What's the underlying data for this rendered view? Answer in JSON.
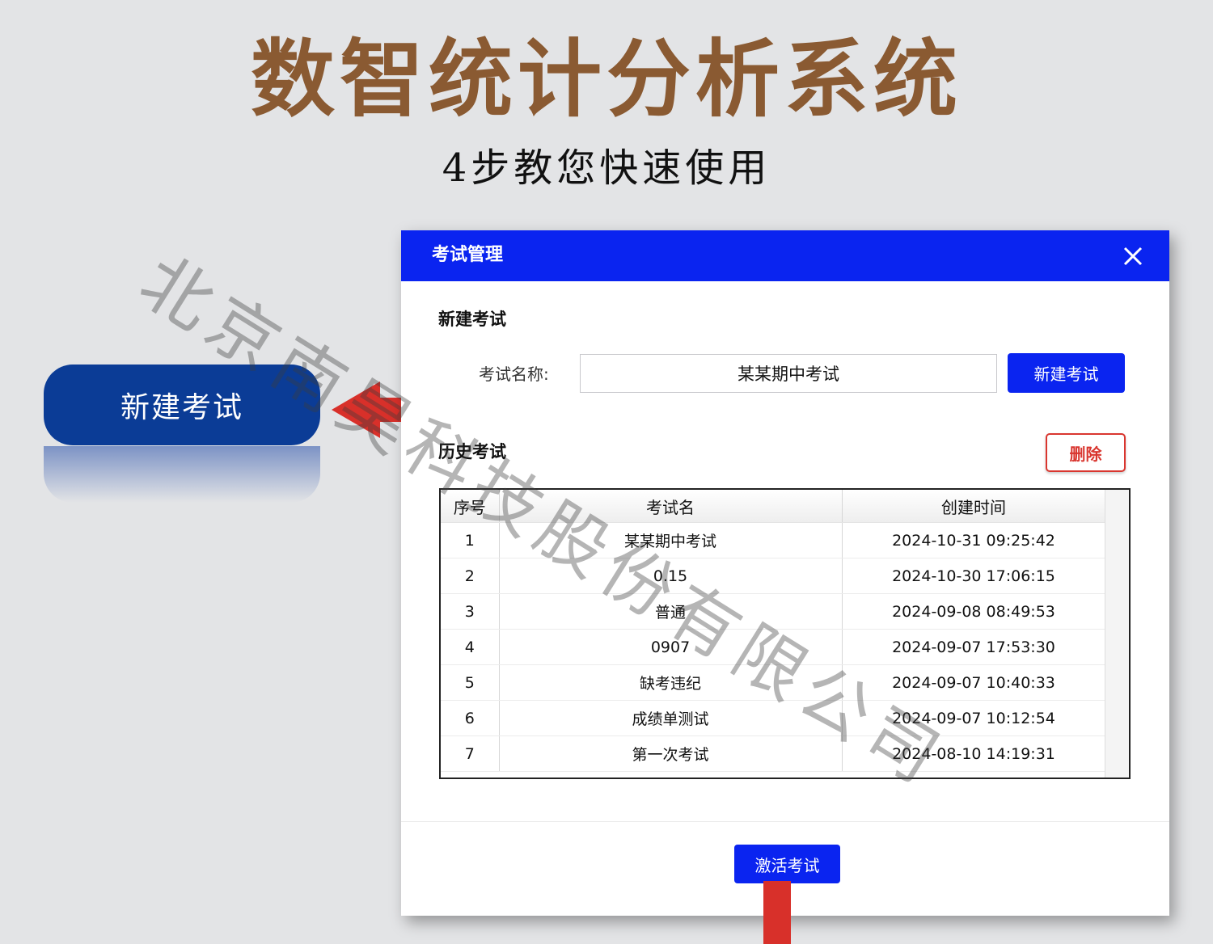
{
  "header": {
    "title": "数智统计分析系统",
    "subtitle": "4步教您快速使用"
  },
  "callout": {
    "label": "新建考试"
  },
  "dialog": {
    "title": "考试管理",
    "new_exam_section": "新建考试",
    "name_label": "考试名称:",
    "name_value": "某某期中考试",
    "create_button": "新建考试",
    "history_section": "历史考试",
    "delete_button": "删除",
    "table": {
      "columns": [
        "序号",
        "考试名",
        "创建时间"
      ],
      "rows": [
        [
          "1",
          "某某期中考试",
          "2024-10-31 09:25:42"
        ],
        [
          "2",
          "0.15",
          "2024-10-30 17:06:15"
        ],
        [
          "3",
          "普通",
          "2024-09-08 08:49:53"
        ],
        [
          "4",
          "0907",
          "2024-09-07 17:53:30"
        ],
        [
          "5",
          "缺考违纪",
          "2024-09-07 10:40:33"
        ],
        [
          "6",
          "成绩单测试",
          "2024-09-07 10:12:54"
        ],
        [
          "7",
          "第一次考试",
          "2024-08-10 14:19:31"
        ]
      ]
    },
    "activate_button": "激活考试"
  },
  "watermark": "北京南昊科技股份有限公司",
  "colors": {
    "title_brown": "#8a5a32",
    "callout_navy": "#0b3c96",
    "dialog_blue": "#0a24f0",
    "arrow_red": "#d8302a",
    "delete_red": "#d9362f"
  },
  "icons": {
    "close": "close-icon",
    "left_arrow": "arrow-left-icon",
    "down_arrow": "arrow-down-icon"
  }
}
